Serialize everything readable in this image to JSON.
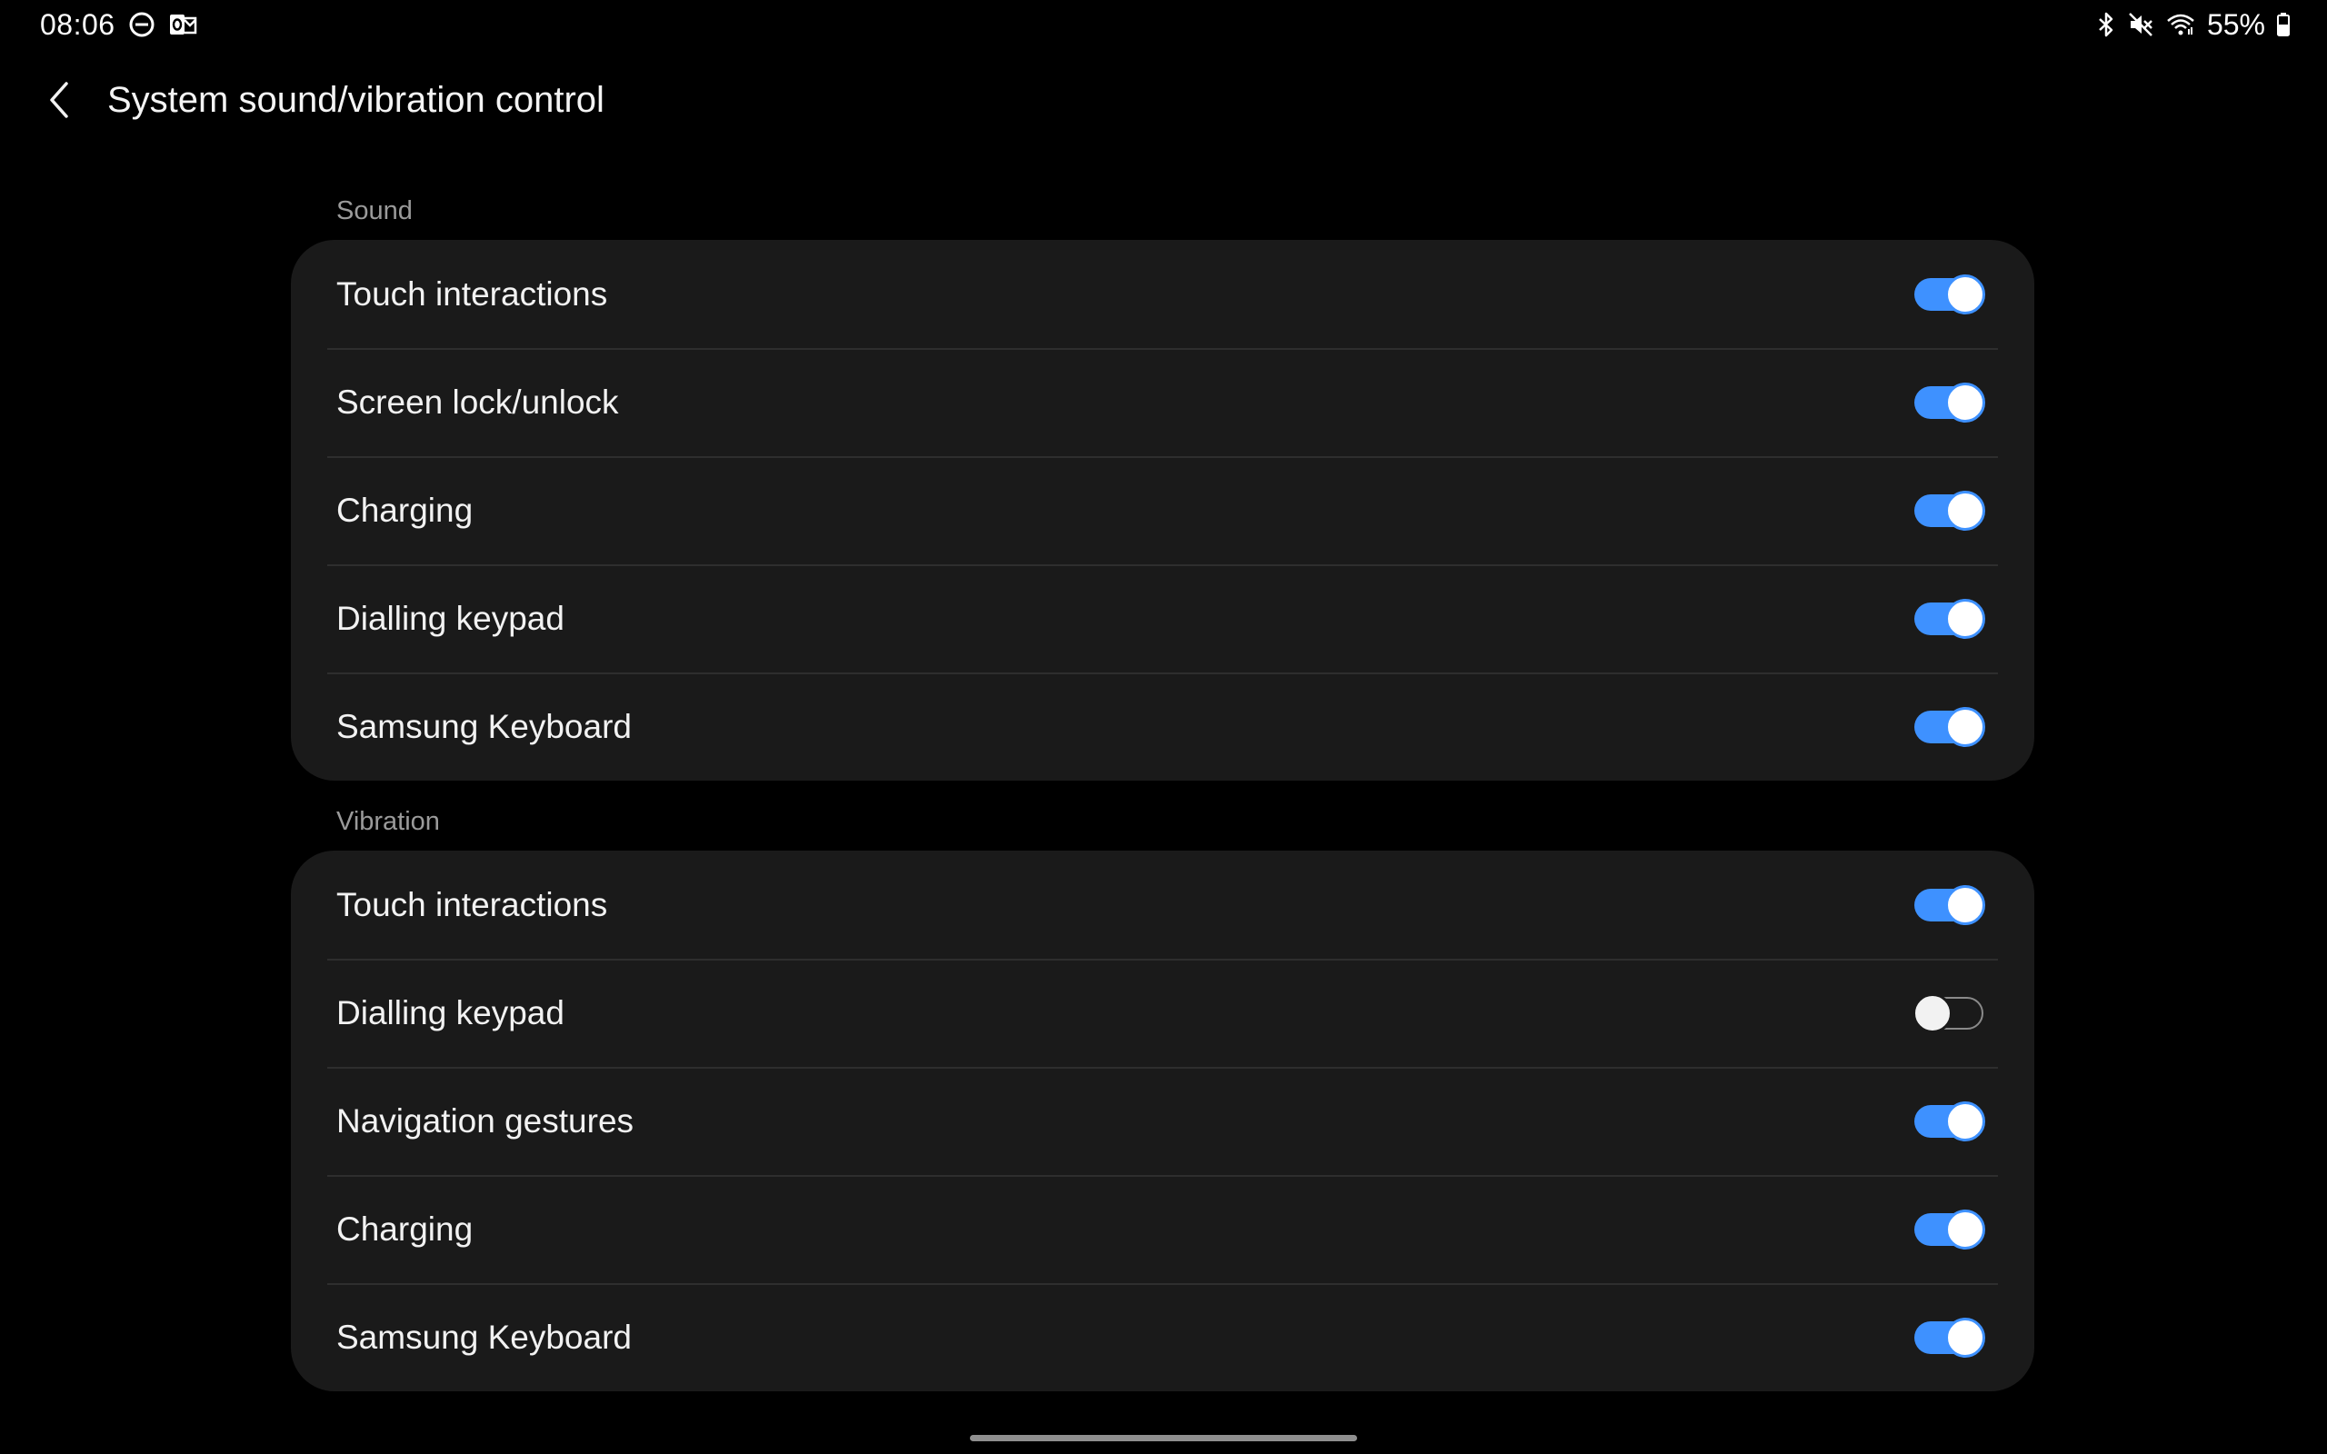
{
  "status_bar": {
    "time": "08:06",
    "left_icons": [
      "do-not-disturb-icon",
      "outlook-icon"
    ],
    "right_icons": [
      "bluetooth-icon",
      "mute-icon",
      "wifi-icon",
      "battery-icon"
    ],
    "battery_percent": "55%"
  },
  "header": {
    "title": "System sound/vibration control"
  },
  "sections": {
    "sound": {
      "label": "Sound",
      "items": [
        {
          "label": "Touch interactions",
          "enabled": true
        },
        {
          "label": "Screen lock/unlock",
          "enabled": true
        },
        {
          "label": "Charging",
          "enabled": true
        },
        {
          "label": "Dialling keypad",
          "enabled": true
        },
        {
          "label": "Samsung Keyboard",
          "enabled": true
        }
      ]
    },
    "vibration": {
      "label": "Vibration",
      "items": [
        {
          "label": "Touch interactions",
          "enabled": true
        },
        {
          "label": "Dialling keypad",
          "enabled": false
        },
        {
          "label": "Navigation gestures",
          "enabled": true
        },
        {
          "label": "Charging",
          "enabled": true
        },
        {
          "label": "Samsung Keyboard",
          "enabled": true
        }
      ]
    }
  },
  "colors": {
    "background": "#000000",
    "card": "#1a1a1a",
    "accent": "#3e91ff",
    "section_label": "#9a9a9a"
  }
}
